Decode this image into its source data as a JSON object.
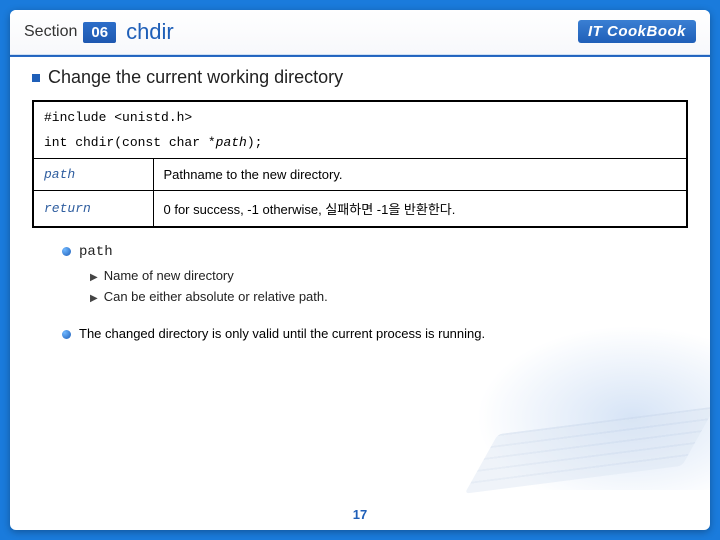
{
  "header": {
    "section_label": "Section",
    "section_num": "06",
    "title": "chdir",
    "brand": "IT CookBook"
  },
  "subtitle": "Change the current working directory",
  "code": {
    "include": "#include <unistd.h>",
    "proto_pre": "int chdir(const char *",
    "proto_param": "path",
    "proto_post": ");"
  },
  "rows": [
    {
      "name": "path",
      "desc": "Pathname to the new directory."
    },
    {
      "name": "return",
      "desc": "0 for success, -1 otherwise, 실패하면 -1을 반환한다."
    }
  ],
  "detail": {
    "heading": "path",
    "items": [
      "Name of new directory",
      "Can be either absolute or relative path."
    ]
  },
  "note": "The changed directory is only valid until the current process is running.",
  "page": "17"
}
